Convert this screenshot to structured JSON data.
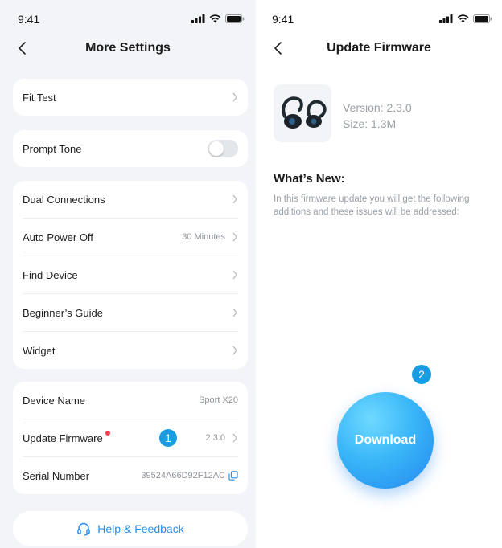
{
  "left": {
    "status_time": "9:41",
    "title": "More Settings",
    "group1": {
      "fit_test": "Fit Test"
    },
    "group2": {
      "prompt_tone": "Prompt Tone"
    },
    "group3": {
      "dual_connections": "Dual Connections",
      "auto_power_off": "Auto Power Off",
      "auto_power_off_value": "30 Minutes",
      "find_device": "Find Device",
      "beginners_guide": "Beginner’s Guide",
      "widget": "Widget"
    },
    "group4": {
      "device_name": "Device Name",
      "device_name_value": "Sport X20",
      "update_firmware": "Update Firmware",
      "update_firmware_value": "2.3.0",
      "serial_number": "Serial Number",
      "serial_number_value": "39524A66D92F12AC"
    },
    "badge": "1",
    "help": "Help & Feedback"
  },
  "right": {
    "status_time": "9:41",
    "title": "Update Firmware",
    "version": "Version: 2.3.0",
    "size": "Size: 1.3M",
    "whats_new": "What’s New:",
    "description": "In this firmware update you will get the following additions and these issues will be addressed:",
    "badge": "2",
    "download": "Download"
  },
  "colors": {
    "accent": "#2a8ee8",
    "badge": "#1a9de0",
    "red_dot": "#f0414f",
    "download_gradient_light": "#39b6f8",
    "download_gradient_dark": "#2487ef"
  }
}
